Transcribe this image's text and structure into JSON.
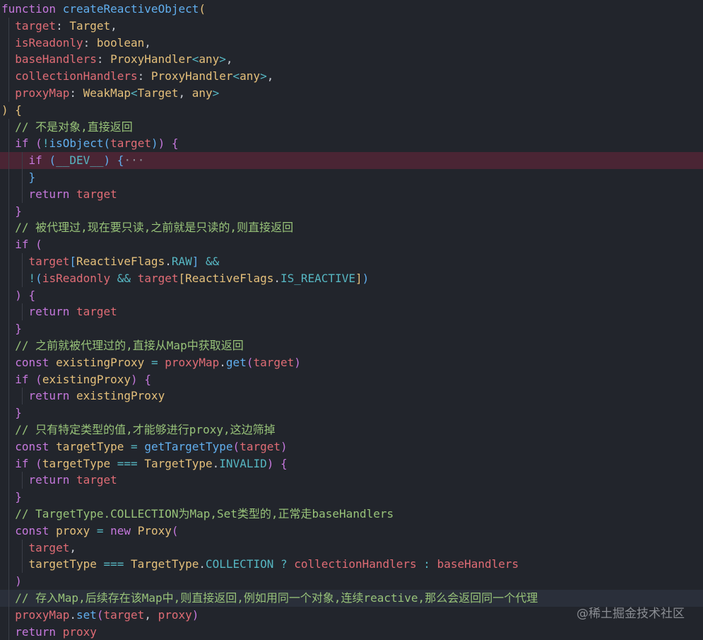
{
  "watermark": "@稀土掘金技术社区",
  "lines": [
    [
      [
        "kw",
        "function "
      ],
      [
        "fn",
        "createReactiveObject"
      ],
      [
        "b1",
        "("
      ]
    ],
    [
      [
        "pl",
        "  "
      ],
      [
        "pr",
        "target"
      ],
      [
        "pl",
        ": "
      ],
      [
        "ty",
        "Target"
      ],
      [
        "pl",
        ","
      ]
    ],
    [
      [
        "pl",
        "  "
      ],
      [
        "pr",
        "isReadonly"
      ],
      [
        "pl",
        ": "
      ],
      [
        "ty",
        "boolean"
      ],
      [
        "pl",
        ","
      ]
    ],
    [
      [
        "pl",
        "  "
      ],
      [
        "pr",
        "baseHandlers"
      ],
      [
        "pl",
        ": "
      ],
      [
        "ty",
        "ProxyHandler"
      ],
      [
        "op",
        "<"
      ],
      [
        "ty",
        "any"
      ],
      [
        "op",
        ">"
      ],
      [
        "pl",
        ","
      ]
    ],
    [
      [
        "pl",
        "  "
      ],
      [
        "pr",
        "collectionHandlers"
      ],
      [
        "pl",
        ": "
      ],
      [
        "ty",
        "ProxyHandler"
      ],
      [
        "op",
        "<"
      ],
      [
        "ty",
        "any"
      ],
      [
        "op",
        ">"
      ],
      [
        "pl",
        ","
      ]
    ],
    [
      [
        "pl",
        "  "
      ],
      [
        "pr",
        "proxyMap"
      ],
      [
        "pl",
        ": "
      ],
      [
        "ty",
        "WeakMap"
      ],
      [
        "op",
        "<"
      ],
      [
        "ty",
        "Target"
      ],
      [
        "pl",
        ", "
      ],
      [
        "ty",
        "any"
      ],
      [
        "op",
        ">"
      ]
    ],
    [
      [
        "b1",
        ")"
      ],
      [
        "pl",
        " "
      ],
      [
        "b1",
        "{"
      ]
    ],
    [
      [
        "pl",
        "  "
      ],
      [
        "cm",
        "// 不是对象,直接返回"
      ]
    ],
    [
      [
        "pl",
        "  "
      ],
      [
        "kw",
        "if"
      ],
      [
        "pl",
        " "
      ],
      [
        "b2",
        "("
      ],
      [
        "op",
        "!"
      ],
      [
        "fn",
        "isObject"
      ],
      [
        "b3",
        "("
      ],
      [
        "pr",
        "target"
      ],
      [
        "b3",
        ")"
      ],
      [
        "b2",
        ")"
      ],
      [
        "pl",
        " "
      ],
      [
        "b2",
        "{"
      ]
    ],
    [
      [
        "pl",
        "    "
      ],
      [
        "kw",
        "if"
      ],
      [
        "pl",
        " "
      ],
      [
        "b3",
        "("
      ],
      [
        "cs",
        "__DEV__"
      ],
      [
        "b3",
        ")"
      ],
      [
        "pl",
        " "
      ],
      [
        "b3",
        "{"
      ],
      [
        "fold",
        "···"
      ]
    ],
    [
      [
        "pl",
        "    "
      ],
      [
        "b3",
        "}"
      ]
    ],
    [
      [
        "pl",
        "    "
      ],
      [
        "kw",
        "return "
      ],
      [
        "pr",
        "target"
      ]
    ],
    [
      [
        "pl",
        "  "
      ],
      [
        "b2",
        "}"
      ]
    ],
    [
      [
        "pl",
        "  "
      ],
      [
        "cm",
        "// 被代理过,现在要只读,之前就是只读的,则直接返回"
      ]
    ],
    [
      [
        "pl",
        "  "
      ],
      [
        "kw",
        "if"
      ],
      [
        "pl",
        " "
      ],
      [
        "b2",
        "("
      ]
    ],
    [
      [
        "pl",
        "    "
      ],
      [
        "pr",
        "target"
      ],
      [
        "b3",
        "["
      ],
      [
        "ty",
        "ReactiveFlags"
      ],
      [
        "pl",
        "."
      ],
      [
        "cs",
        "RAW"
      ],
      [
        "b3",
        "]"
      ],
      [
        "pl",
        " "
      ],
      [
        "op",
        "&&"
      ]
    ],
    [
      [
        "pl",
        "    "
      ],
      [
        "op",
        "!"
      ],
      [
        "b3",
        "("
      ],
      [
        "pr",
        "isReadonly"
      ],
      [
        "pl",
        " "
      ],
      [
        "op",
        "&&"
      ],
      [
        "pl",
        " "
      ],
      [
        "pr",
        "target"
      ],
      [
        "b1",
        "["
      ],
      [
        "ty",
        "ReactiveFlags"
      ],
      [
        "pl",
        "."
      ],
      [
        "cs",
        "IS_REACTIVE"
      ],
      [
        "b1",
        "]"
      ],
      [
        "b3",
        ")"
      ]
    ],
    [
      [
        "pl",
        "  "
      ],
      [
        "b2",
        ")"
      ],
      [
        "pl",
        " "
      ],
      [
        "b2",
        "{"
      ]
    ],
    [
      [
        "pl",
        "    "
      ],
      [
        "kw",
        "return "
      ],
      [
        "pr",
        "target"
      ]
    ],
    [
      [
        "pl",
        "  "
      ],
      [
        "b2",
        "}"
      ]
    ],
    [
      [
        "pl",
        "  "
      ],
      [
        "cm",
        "// 之前就被代理过的,直接从Map中获取返回"
      ]
    ],
    [
      [
        "pl",
        "  "
      ],
      [
        "kw",
        "const "
      ],
      [
        "ty",
        "existingProxy"
      ],
      [
        "pl",
        " "
      ],
      [
        "op",
        "="
      ],
      [
        "pl",
        " "
      ],
      [
        "pr",
        "proxyMap"
      ],
      [
        "pl",
        "."
      ],
      [
        "fn",
        "get"
      ],
      [
        "b2",
        "("
      ],
      [
        "pr",
        "target"
      ],
      [
        "b2",
        ")"
      ]
    ],
    [
      [
        "pl",
        "  "
      ],
      [
        "kw",
        "if"
      ],
      [
        "pl",
        " "
      ],
      [
        "b2",
        "("
      ],
      [
        "ty",
        "existingProxy"
      ],
      [
        "b2",
        ")"
      ],
      [
        "pl",
        " "
      ],
      [
        "b2",
        "{"
      ]
    ],
    [
      [
        "pl",
        "    "
      ],
      [
        "kw",
        "return "
      ],
      [
        "ty",
        "existingProxy"
      ]
    ],
    [
      [
        "pl",
        "  "
      ],
      [
        "b2",
        "}"
      ]
    ],
    [
      [
        "pl",
        "  "
      ],
      [
        "cm",
        "// 只有特定类型的值,才能够进行proxy,这边筛掉"
      ]
    ],
    [
      [
        "pl",
        "  "
      ],
      [
        "kw",
        "const "
      ],
      [
        "ty",
        "targetType"
      ],
      [
        "pl",
        " "
      ],
      [
        "op",
        "="
      ],
      [
        "pl",
        " "
      ],
      [
        "fn",
        "getTargetType"
      ],
      [
        "b2",
        "("
      ],
      [
        "pr",
        "target"
      ],
      [
        "b2",
        ")"
      ]
    ],
    [
      [
        "pl",
        "  "
      ],
      [
        "kw",
        "if"
      ],
      [
        "pl",
        " "
      ],
      [
        "b2",
        "("
      ],
      [
        "ty",
        "targetType"
      ],
      [
        "pl",
        " "
      ],
      [
        "op",
        "==="
      ],
      [
        "pl",
        " "
      ],
      [
        "ty",
        "TargetType"
      ],
      [
        "pl",
        "."
      ],
      [
        "cs",
        "INVALID"
      ],
      [
        "b2",
        ")"
      ],
      [
        "pl",
        " "
      ],
      [
        "b2",
        "{"
      ]
    ],
    [
      [
        "pl",
        "    "
      ],
      [
        "kw",
        "return "
      ],
      [
        "pr",
        "target"
      ]
    ],
    [
      [
        "pl",
        "  "
      ],
      [
        "b2",
        "}"
      ]
    ],
    [
      [
        "pl",
        "  "
      ],
      [
        "cm",
        "// TargetType.COLLECTION为Map,Set类型的,正常走baseHandlers"
      ]
    ],
    [
      [
        "pl",
        "  "
      ],
      [
        "kw",
        "const "
      ],
      [
        "ty",
        "proxy"
      ],
      [
        "pl",
        " "
      ],
      [
        "op",
        "="
      ],
      [
        "pl",
        " "
      ],
      [
        "kw",
        "new "
      ],
      [
        "ty",
        "Proxy"
      ],
      [
        "b2",
        "("
      ]
    ],
    [
      [
        "pl",
        "    "
      ],
      [
        "pr",
        "target"
      ],
      [
        "pl",
        ","
      ]
    ],
    [
      [
        "pl",
        "    "
      ],
      [
        "ty",
        "targetType"
      ],
      [
        "pl",
        " "
      ],
      [
        "op",
        "==="
      ],
      [
        "pl",
        " "
      ],
      [
        "ty",
        "TargetType"
      ],
      [
        "pl",
        "."
      ],
      [
        "cs",
        "COLLECTION"
      ],
      [
        "pl",
        " "
      ],
      [
        "op",
        "?"
      ],
      [
        "pl",
        " "
      ],
      [
        "pr",
        "collectionHandlers"
      ],
      [
        "pl",
        " "
      ],
      [
        "op",
        ":"
      ],
      [
        "pl",
        " "
      ],
      [
        "pr",
        "baseHandlers"
      ]
    ],
    [
      [
        "pl",
        "  "
      ],
      [
        "b2",
        ")"
      ]
    ],
    [
      [
        "pl",
        "  "
      ],
      [
        "cm",
        "// 存入Map,后续存在该Map中,则直接返回,例如用同一个对象,连续reactive,那么会返回同一个代理"
      ]
    ],
    [
      [
        "pl",
        "  "
      ],
      [
        "pr",
        "proxyMap"
      ],
      [
        "pl",
        "."
      ],
      [
        "fn",
        "set"
      ],
      [
        "b2",
        "("
      ],
      [
        "pr",
        "target"
      ],
      [
        "pl",
        ", "
      ],
      [
        "pr",
        "proxy"
      ],
      [
        "b2",
        ")"
      ]
    ],
    [
      [
        "pl",
        "  "
      ],
      [
        "kw",
        "return "
      ],
      [
        "pr",
        "proxy"
      ]
    ]
  ]
}
